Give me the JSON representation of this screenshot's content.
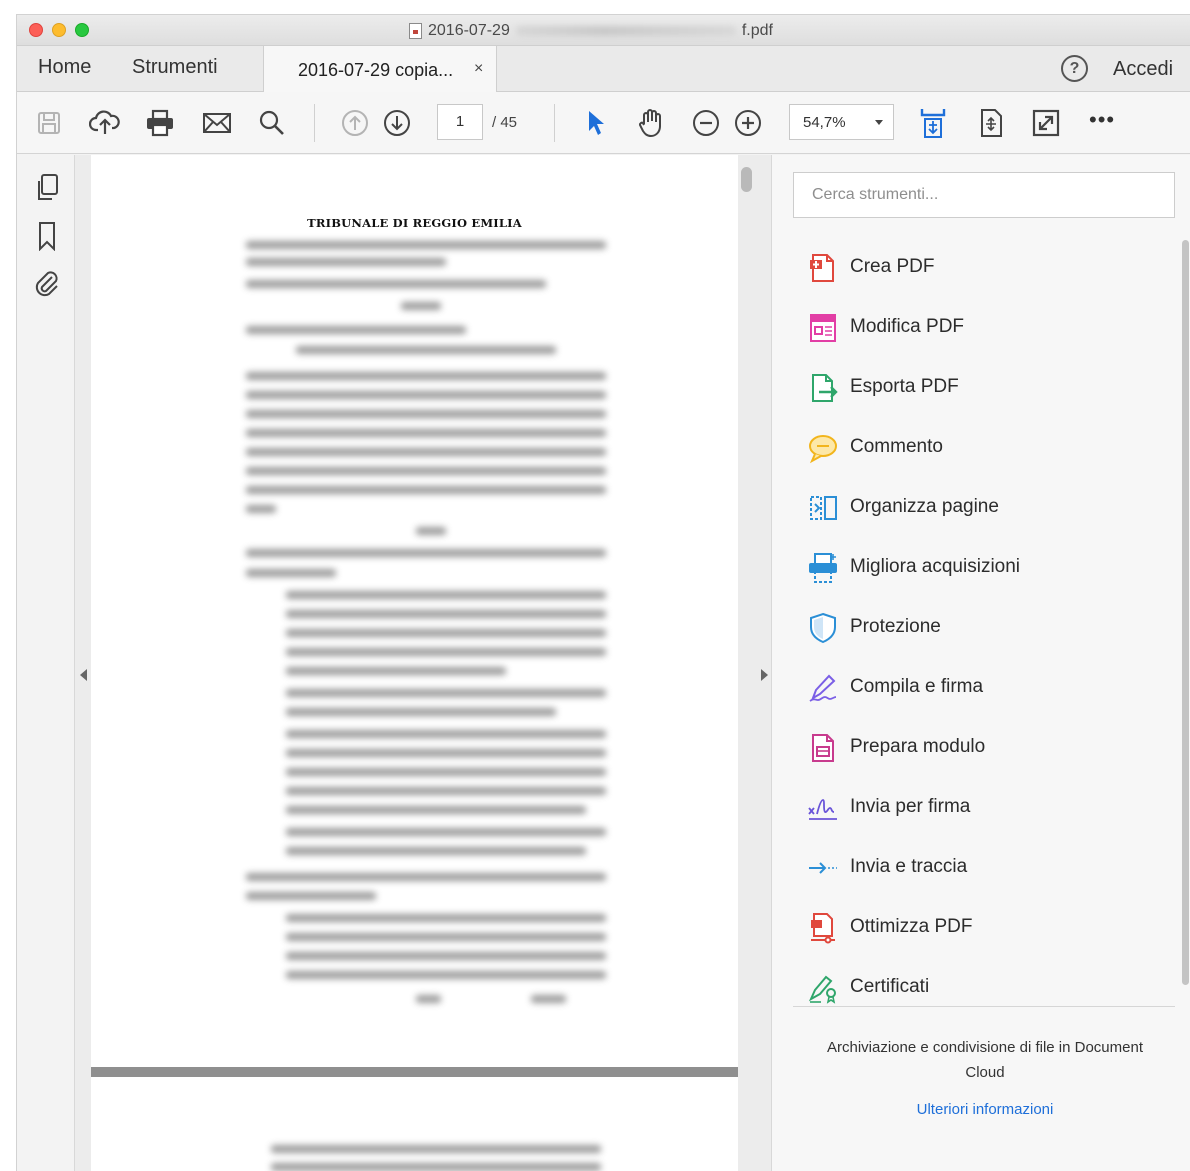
{
  "window": {
    "title_prefix": "2016-07-29",
    "title_suffix": "f.pdf"
  },
  "tabs": {
    "home": "Home",
    "tools": "Strumenti",
    "document": "2016-07-29 copia...",
    "close_glyph": "×",
    "help_glyph": "?",
    "signin": "Accedi"
  },
  "toolbar": {
    "page_current": "1",
    "page_total": "/ 45",
    "zoom": "54,7%",
    "more": "•••"
  },
  "document": {
    "heading": "TRIBUNALE DI REGGIO EMILIA"
  },
  "tools_pane": {
    "search_placeholder": "Cerca strumenti...",
    "items": [
      {
        "label": "Crea PDF",
        "icon": "create-pdf-icon",
        "color": "#e0483d"
      },
      {
        "label": "Modifica PDF",
        "icon": "edit-pdf-icon",
        "color": "#e23ea5"
      },
      {
        "label": "Esporta PDF",
        "icon": "export-pdf-icon",
        "color": "#2fa66b"
      },
      {
        "label": "Commento",
        "icon": "comment-icon",
        "color": "#f2b51c"
      },
      {
        "label": "Organizza pagine",
        "icon": "organize-pages-icon",
        "color": "#2b8fd6"
      },
      {
        "label": "Migliora acquisizioni",
        "icon": "enhance-scans-icon",
        "color": "#2b8fd6"
      },
      {
        "label": "Protezione",
        "icon": "protect-icon",
        "color": "#2b8fd6"
      },
      {
        "label": "Compila e firma",
        "icon": "fill-sign-icon",
        "color": "#7b5fe6"
      },
      {
        "label": "Prepara modulo",
        "icon": "prepare-form-icon",
        "color": "#c83b8e"
      },
      {
        "label": "Invia per firma",
        "icon": "send-for-signature-icon",
        "color": "#6a55d9"
      },
      {
        "label": "Invia e traccia",
        "icon": "send-track-icon",
        "color": "#2b8fd6"
      },
      {
        "label": "Ottimizza PDF",
        "icon": "optimize-pdf-icon",
        "color": "#e0483d"
      },
      {
        "label": "Certificati",
        "icon": "certificates-icon",
        "color": "#2fa66b"
      }
    ],
    "cloud_text": "Archiviazione e condivisione di file in Document Cloud",
    "cloud_link": "Ulteriori informazioni"
  },
  "colors": {
    "accent_blue": "#1e6fd9",
    "traffic_red": "#fc5f57",
    "traffic_yellow": "#fdbc2e",
    "traffic_green": "#28c840"
  }
}
